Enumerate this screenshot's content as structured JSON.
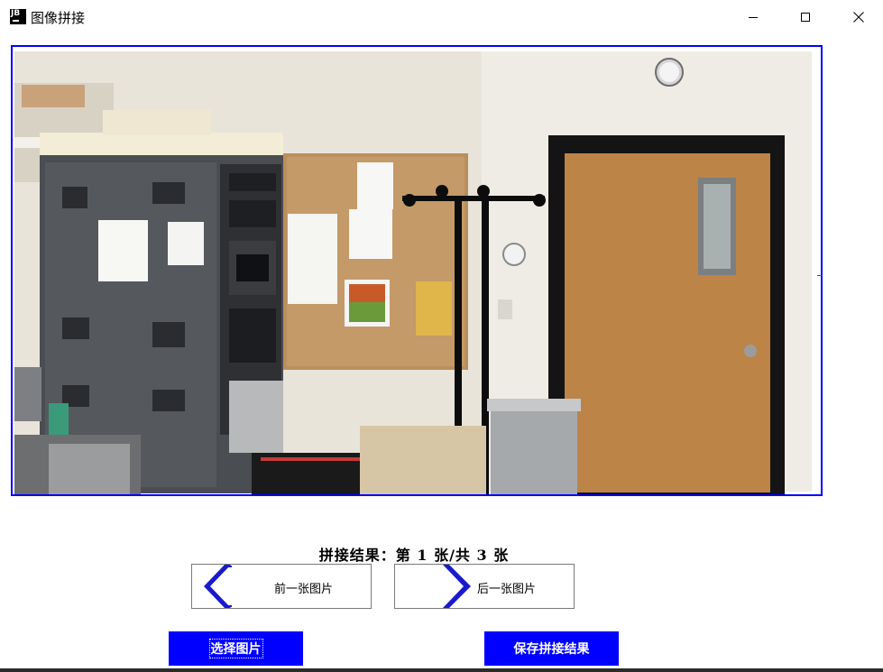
{
  "window": {
    "app_icon_text": "JB",
    "title": "图像拼接",
    "controls": [
      "minimize-icon",
      "maximize-icon",
      "close-icon"
    ]
  },
  "result": {
    "label": "拼接结果：第 1 张/共 3 张"
  },
  "navigation": {
    "prev_label": "前一张图片",
    "prev_icon": "chevron-left-icon",
    "next_label": "后一张图片",
    "next_icon": "chevron-right-icon"
  },
  "actions": {
    "select_label": "选择图片",
    "save_label": "保存拼接结果"
  },
  "colors": {
    "accent": "#0000ff",
    "frame_border": "#0000ff",
    "chevron": "#1a1acd"
  }
}
